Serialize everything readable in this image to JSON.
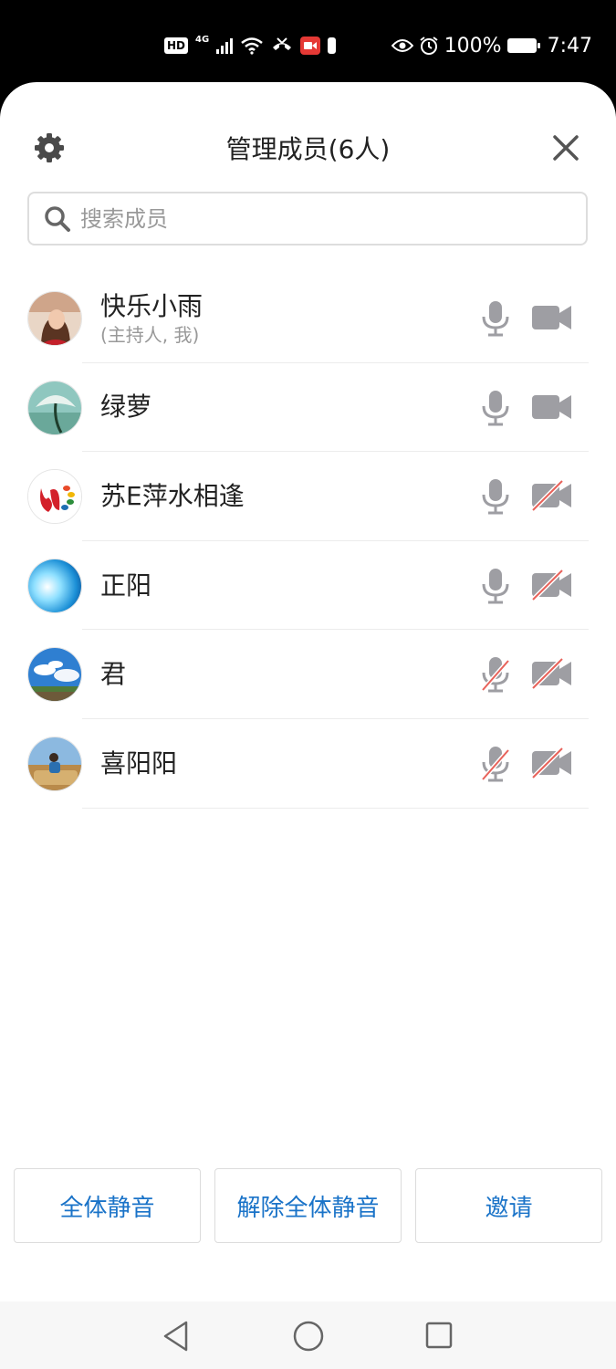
{
  "status_bar": {
    "hd": "HD",
    "network": "4G",
    "battery_percent": "100%",
    "time": "7:47",
    "icons": [
      "hd-icon",
      "signal-icon",
      "wifi-icon",
      "call-icon",
      "video-record-icon",
      "battery-small-icon",
      "eye-icon",
      "alarm-icon",
      "battery-icon"
    ]
  },
  "header": {
    "title": "管理成员(6人)"
  },
  "search": {
    "placeholder": "搜索成员"
  },
  "members": [
    {
      "name": "快乐小雨",
      "subtitle": "(主持人, 我)",
      "mic_on": true,
      "cam_on": true
    },
    {
      "name": "绿萝",
      "subtitle": "",
      "mic_on": true,
      "cam_on": true
    },
    {
      "name": "苏E萍水相逢",
      "subtitle": "",
      "mic_on": true,
      "cam_on": false
    },
    {
      "name": "正阳",
      "subtitle": "",
      "mic_on": true,
      "cam_on": false
    },
    {
      "name": "君",
      "subtitle": "",
      "mic_on": false,
      "cam_on": false
    },
    {
      "name": "喜阳阳",
      "subtitle": "",
      "mic_on": false,
      "cam_on": false
    }
  ],
  "actions": {
    "mute_all": "全体静音",
    "unmute_all": "解除全体静音",
    "invite": "邀请"
  },
  "colors": {
    "accent": "#1a73c8",
    "icon_gray": "#9e9ea3",
    "off_slash": "#e8625a"
  }
}
